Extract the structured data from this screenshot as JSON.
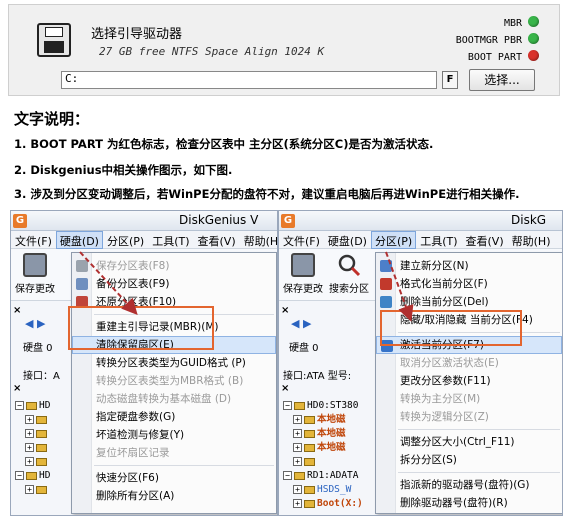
{
  "boot_panel": {
    "title": "选择引导驱动器",
    "drive_info": "27 GB free NTFS Space Align 1024 K",
    "path_value": "C:",
    "f_button": "F",
    "browse_button": "选择...",
    "status": [
      {
        "label": "MBR",
        "color": "#39b54a"
      },
      {
        "label": "BOOTMGR PBR",
        "color": "#39b54a"
      },
      {
        "label": "BOOT PART",
        "color": "#d9312b"
      }
    ]
  },
  "description": {
    "heading": "文字说明：",
    "lines": [
      "1. BOOT PART 为红色标志，检查分区表中 主分区(系统分区C)是否为激活状态.",
      "2. Diskgenius中相关操作图示，如下图.",
      "3. 涉及到分区变动调整后，若WinPE分配的盘符不对，建议重启电脑后再进WinPE进行相关操作."
    ]
  },
  "left_window": {
    "title": "DiskGenius V",
    "menus": [
      "文件(F)",
      "硬盘(D)",
      "分区(P)",
      "工具(T)",
      "查看(V)",
      "帮助(H)"
    ],
    "toolbar": [
      "保存更改"
    ],
    "disk_label": "硬盘 0",
    "iface_label": "接口：A",
    "dropdown": [
      {
        "label": "保存分区表(F8)",
        "disabled": true,
        "icon": "save-icon"
      },
      {
        "label": "备份分区表(F9)",
        "disabled": false,
        "icon": "backup-icon"
      },
      {
        "label": "还原分区表(F10)",
        "disabled": false,
        "icon": "restore-icon"
      },
      {
        "sep": true
      },
      {
        "label": "重建主引导记录(MBR)(M)",
        "disabled": false
      },
      {
        "label": "清除保留扇区(E)",
        "disabled": false,
        "selected": true
      },
      {
        "label": "转换分区表类型为GUID格式 (P)",
        "disabled": false
      },
      {
        "label": "转换分区表类型为MBR格式 (B)",
        "disabled": true
      },
      {
        "label": "动态磁盘转换为基本磁盘 (D)",
        "disabled": true
      },
      {
        "label": "指定硬盘参数(G)",
        "disabled": false
      },
      {
        "label": "坏道检测与修复(Y)",
        "disabled": false
      },
      {
        "label": "复位坏扇区记录",
        "disabled": true
      },
      {
        "sep": true
      },
      {
        "label": "快速分区(F6)",
        "disabled": false
      },
      {
        "label": "删除所有分区(A)",
        "disabled": false
      }
    ],
    "tree": [
      "HD",
      "",
      "",
      "",
      "",
      "HD",
      ""
    ]
  },
  "right_window": {
    "title": "DiskG",
    "menus": [
      "文件(F)",
      "硬盘(D)",
      "分区(P)",
      "工具(T)",
      "查看(V)",
      "帮助(H)"
    ],
    "toolbar": [
      "保存更改",
      "搜索分区"
    ],
    "disk_label": "硬盘 0",
    "iface_label": "接口:ATA  型号:",
    "dropdown": [
      {
        "label": "建立新分区(N)",
        "disabled": false,
        "icon": "new-partition-icon"
      },
      {
        "label": "格式化当前分区(F)",
        "disabled": false,
        "icon": "format-icon"
      },
      {
        "label": "删除当前分区(Del)",
        "disabled": false,
        "icon": "delete-icon"
      },
      {
        "label": "隐藏/取消隐藏 当前分区(F4)",
        "disabled": false
      },
      {
        "sep": true
      },
      {
        "label": "激活当前分区(F7)",
        "disabled": false,
        "selected": true,
        "icon": "activate-icon"
      },
      {
        "label": "取消分区激活状态(E)",
        "disabled": true
      },
      {
        "label": "更改分区参数(F11)",
        "disabled": false
      },
      {
        "label": "转换为主分区(M)",
        "disabled": true
      },
      {
        "label": "转换为逻辑分区(Z)",
        "disabled": true
      },
      {
        "sep": true
      },
      {
        "label": "调整分区大小(Ctrl_F11)",
        "disabled": false
      },
      {
        "label": "拆分分区(S)",
        "disabled": false
      },
      {
        "sep": true
      },
      {
        "label": "指派新的驱动器号(盘符)(G)",
        "disabled": false
      },
      {
        "label": "删除驱动器号(盘符)(R)",
        "disabled": false
      }
    ],
    "tree": [
      "HD0:ST380",
      "本地磁",
      "本地磁",
      "本地磁",
      "",
      "RD1:ADATA",
      "HSDS_W",
      "Boot(X:)"
    ]
  },
  "colors": {
    "highlight_box": "#e3652f",
    "arrow": "#b03030"
  }
}
